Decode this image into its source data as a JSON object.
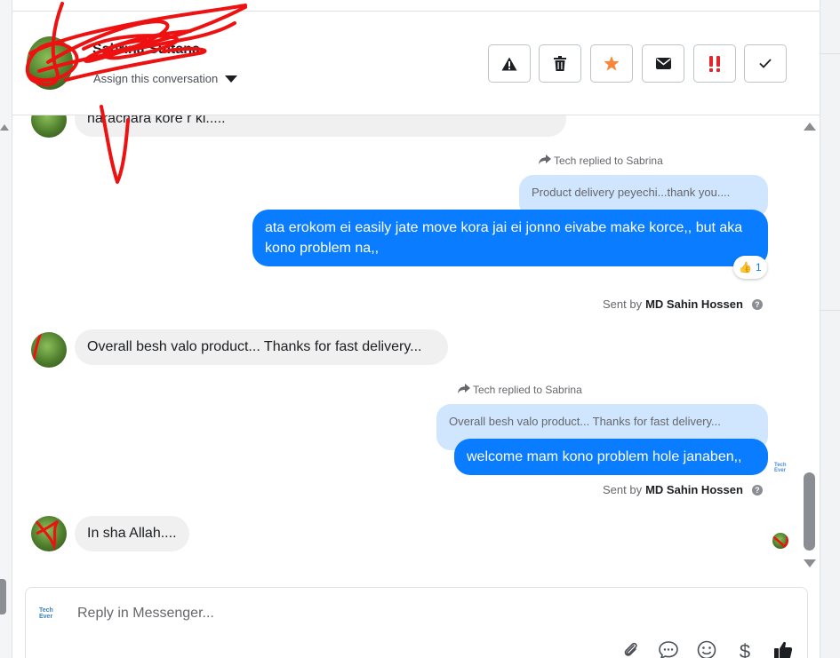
{
  "header": {
    "contact_name": "Sabrina Sultana",
    "assign_label": "Assign this conversation"
  },
  "toolbar": {
    "spam_icon": "warning-icon",
    "delete_icon": "trash-icon",
    "star_icon": "star-icon",
    "mark_unread_icon": "envelope-icon",
    "important_icon": "exclamation-icon",
    "done_icon": "check-icon",
    "colors": {
      "star": "#f5883a",
      "important": "#e4252c",
      "icon": "#1c1e21"
    }
  },
  "conversation": {
    "msg0_text": "harachara kore r ki.....",
    "reply1_label": "Tech replied to Sabrina",
    "reply1_quote": "Product delivery peyechi...thank you....",
    "reply1_text": "ata erokom ei easily jate move kora jai ei jonno eivabe make korce,, but aka kono problem na,,",
    "reaction_emoji": "👍",
    "reaction_count": "1",
    "sent1_prefix": "Sent by",
    "sent1_name": "MD Sahin Hossen",
    "msg2_text": "Overall besh valo product... Thanks  for fast delivery...",
    "reply2_label": "Tech replied to Sabrina",
    "reply2_quote": "Overall besh valo product... Thanks for fast delivery...",
    "reply2_text": "welcome mam kono problem hole janaben,,",
    "sent2_prefix": "Sent by",
    "sent2_name": "MD Sahin Hossen",
    "msg3_text": "In sha Allah....",
    "help_glyph": "?",
    "brand_top": "Tech",
    "brand_bottom": "Ever"
  },
  "composer": {
    "placeholder": "Reply in Messenger...",
    "brand_top": "Tech",
    "brand_bottom": "Ever",
    "icons": [
      "paperclip-icon",
      "chat-bubble-icon",
      "smiley-icon",
      "dollar-icon",
      "thumbs-up-icon"
    ],
    "dollar_glyph": "$"
  },
  "colors": {
    "outgoing_bubble": "#0a7cff",
    "quoted_bubble": "#d0e5fe",
    "incoming_bubble": "#f0f0f0",
    "redaction": "#ee1111"
  }
}
